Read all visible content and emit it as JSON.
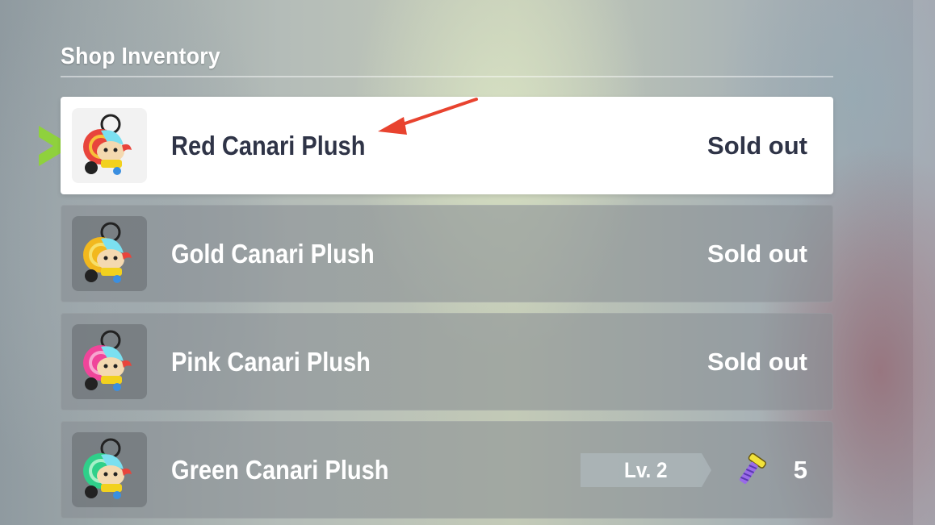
{
  "header": {
    "title": "Shop Inventory"
  },
  "items": [
    {
      "name": "Red Canari Plush",
      "status": "Sold out",
      "selected": true,
      "accent": "#e8453c"
    },
    {
      "name": "Gold Canari Plush",
      "status": "Sold out",
      "selected": false,
      "accent": "#f2b81e"
    },
    {
      "name": "Pink Canari Plush",
      "status": "Sold out",
      "selected": false,
      "accent": "#f0459a"
    },
    {
      "name": "Green Canari Plush",
      "status": "",
      "selected": false,
      "accent": "#2fd08a",
      "level": "Lv. 2",
      "cost": "5",
      "cost_icon": "screw-icon"
    }
  ],
  "colors": {
    "selected_bg": "#ffffff",
    "selected_text": "#2f3447",
    "cursor": "#8fd13d",
    "annotation_arrow": "#e8432f"
  }
}
